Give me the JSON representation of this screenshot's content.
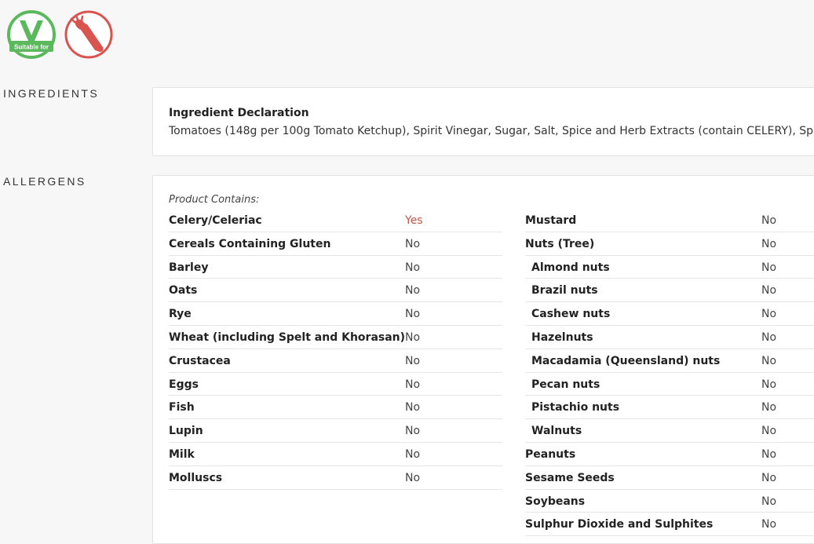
{
  "badges": [
    {
      "icon": "vegan-v-icon",
      "label": "Suitable for",
      "color": "#4caf50"
    },
    {
      "icon": "no-celery-icon",
      "color": "#d9534f"
    }
  ],
  "sections": {
    "ingredients_title": "INGREDIENTS",
    "allergens_title": "ALLERGENS"
  },
  "ingredients": {
    "heading": "Ingredient Declaration",
    "text": "Tomatoes (148g per 100g Tomato Ketchup), Spirit Vinegar, Sugar, Salt, Spice and Herb Extracts (contain CELERY), Spice."
  },
  "allergens": {
    "contains_label": "Product Contains:",
    "left": [
      {
        "name": "Celery/Celeriac",
        "value": "Yes"
      },
      {
        "name": "Cereals Containing Gluten",
        "value": "No"
      },
      {
        "name": "Barley",
        "value": "No"
      },
      {
        "name": "Oats",
        "value": "No"
      },
      {
        "name": "Rye",
        "value": "No"
      },
      {
        "name": "Wheat (including Spelt and Khorasan)",
        "value": "No"
      },
      {
        "name": "Crustacea",
        "value": "No"
      },
      {
        "name": "Eggs",
        "value": "No"
      },
      {
        "name": "Fish",
        "value": "No"
      },
      {
        "name": "Lupin",
        "value": "No"
      },
      {
        "name": "Milk",
        "value": "No"
      },
      {
        "name": "Molluscs",
        "value": "No"
      }
    ],
    "right": [
      {
        "name": "Mustard",
        "value": "No"
      },
      {
        "name": "Nuts (Tree)",
        "value": "No"
      },
      {
        "name": "Almond nuts",
        "value": "No",
        "sub": true
      },
      {
        "name": "Brazil nuts",
        "value": "No",
        "sub": true
      },
      {
        "name": "Cashew nuts",
        "value": "No",
        "sub": true
      },
      {
        "name": "Hazelnuts",
        "value": "No",
        "sub": true
      },
      {
        "name": "Macadamia (Queensland) nuts",
        "value": "No",
        "sub": true
      },
      {
        "name": "Pecan nuts",
        "value": "No",
        "sub": true
      },
      {
        "name": "Pistachio nuts",
        "value": "No",
        "sub": true
      },
      {
        "name": "Walnuts",
        "value": "No",
        "sub": true
      },
      {
        "name": "Peanuts",
        "value": "No"
      },
      {
        "name": "Sesame Seeds",
        "value": "No"
      },
      {
        "name": "Soybeans",
        "value": "No"
      },
      {
        "name": "Sulphur Dioxide and Sulphites",
        "value": "No"
      }
    ]
  }
}
